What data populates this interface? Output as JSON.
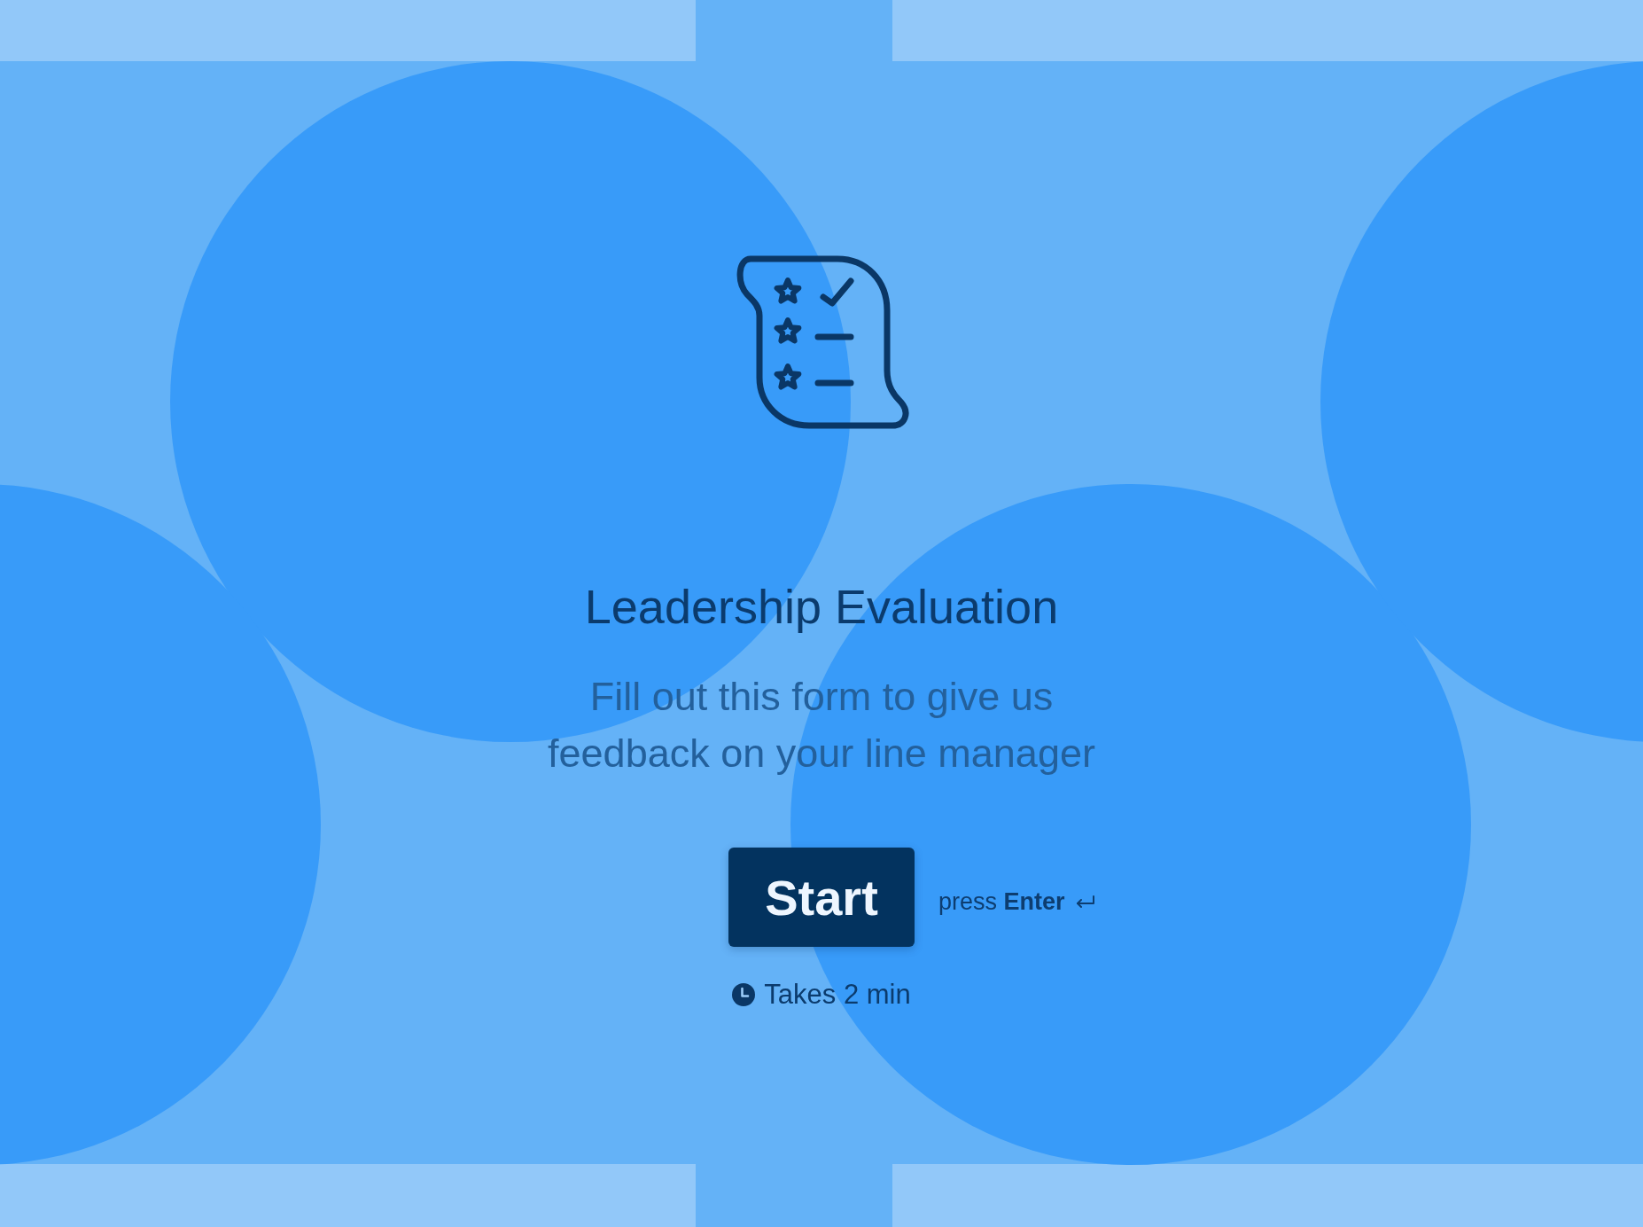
{
  "intro": {
    "title": "Leadership Evaluation",
    "description": "Fill out this form to give us feedback on your line manager",
    "start_button": "Start",
    "keyboard_hint": "press **Enter**",
    "duration": "Takes 2 min"
  }
}
